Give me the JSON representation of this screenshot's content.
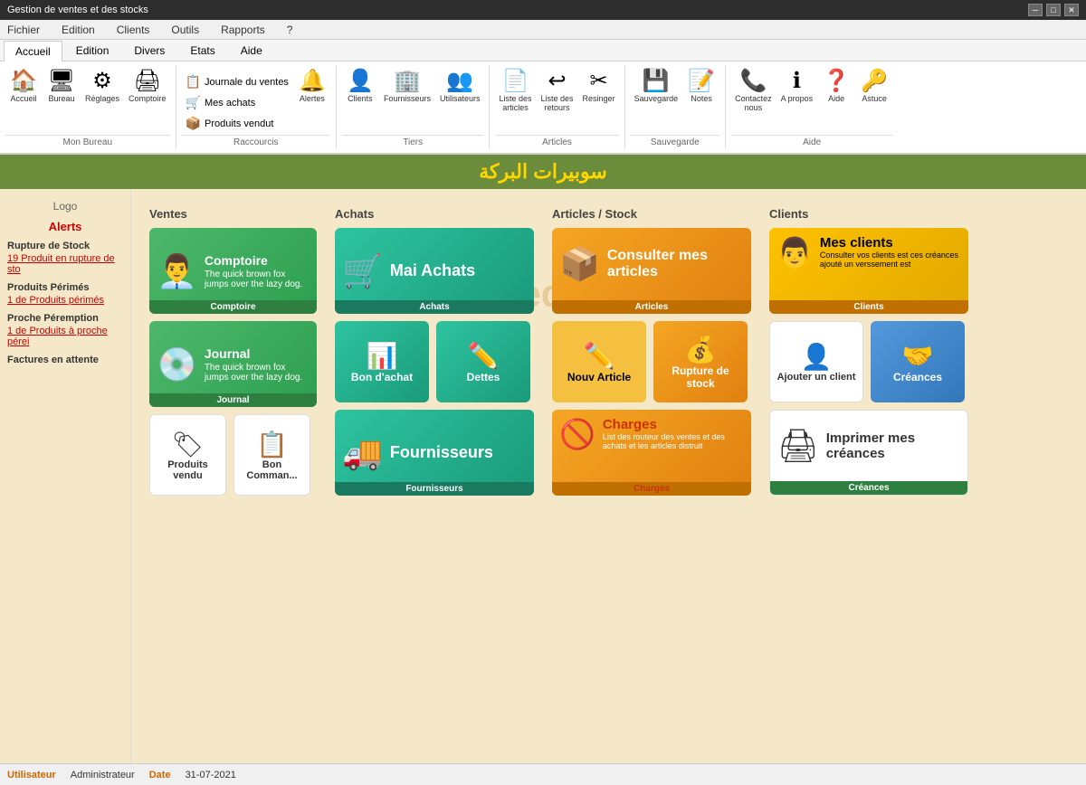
{
  "titlebar": {
    "title": "Gestion de ventes et des stocks",
    "controls": [
      "minimize",
      "maximize",
      "close"
    ]
  },
  "menubar": {
    "items": [
      "Fichier",
      "Edition",
      "Clients",
      "Outils",
      "Rapports",
      "?"
    ]
  },
  "ribbon": {
    "tabs": [
      {
        "label": "Accueil",
        "active": true
      },
      {
        "label": "Edition"
      },
      {
        "label": "Divers"
      },
      {
        "label": "Etats"
      },
      {
        "label": "Aide"
      }
    ],
    "groups": [
      {
        "name": "Mon Bureau",
        "items": [
          {
            "type": "large",
            "icon": "🏠",
            "label": "Accueil"
          },
          {
            "type": "large",
            "icon": "🖥",
            "label": "Bureau"
          },
          {
            "type": "large",
            "icon": "⚙",
            "label": "Réglages"
          },
          {
            "type": "large",
            "icon": "🖨",
            "label": "Comptoire"
          }
        ]
      },
      {
        "name": "Raccourcis",
        "items_small": [
          {
            "icon": "📋",
            "label": "Journale du ventes"
          },
          {
            "icon": "🛒",
            "label": "Mes achats"
          },
          {
            "icon": "📦",
            "label": "Produits vendut"
          }
        ],
        "items_large": [
          {
            "type": "large",
            "icon": "🔔",
            "label": "Alertes"
          }
        ]
      },
      {
        "name": "Tiers",
        "items": [
          {
            "type": "large",
            "icon": "👤",
            "label": "Clients"
          },
          {
            "type": "large",
            "icon": "🏢",
            "label": "Fournisseurs"
          },
          {
            "type": "large",
            "icon": "👥",
            "label": "Utilisateurs"
          }
        ]
      },
      {
        "name": "Articles",
        "items": [
          {
            "type": "large",
            "icon": "📄",
            "label": "Liste des\narticles"
          },
          {
            "type": "large",
            "icon": "↩",
            "label": "Liste des\nretours"
          },
          {
            "type": "large",
            "icon": "✂",
            "label": "Resinger"
          }
        ]
      },
      {
        "name": "Sauvegarde",
        "items": [
          {
            "type": "large",
            "icon": "💾",
            "label": "Sauvegarde"
          },
          {
            "type": "large",
            "icon": "📝",
            "label": "Notes"
          }
        ]
      },
      {
        "name": "Aide",
        "items": [
          {
            "type": "large",
            "icon": "📞",
            "label": "Contactez\nnous"
          },
          {
            "type": "large",
            "icon": "ℹ",
            "label": "A propos"
          },
          {
            "type": "large",
            "icon": "❓",
            "label": "Aide"
          },
          {
            "type": "large",
            "icon": "🔑",
            "label": "Astuce"
          }
        ]
      }
    ]
  },
  "brand": {
    "name": "سوبيرات البركة"
  },
  "sidebar": {
    "logo_label": "Logo",
    "alerts_label": "Alerts",
    "sections": [
      {
        "label": "Rupture de Stock",
        "items": [
          "19 Produit en rupture de sto"
        ]
      },
      {
        "label": "Produits Périmés",
        "items": [
          "1 de Produits périmés"
        ]
      },
      {
        "label": "Proche Péremption",
        "items": [
          "1 de Produits à proche pérei"
        ]
      },
      {
        "label": "Factures en attente",
        "items": []
      }
    ]
  },
  "dashboard": {
    "sections": [
      {
        "id": "ventes",
        "label": "Ventes",
        "cards": [
          {
            "id": "comptoire",
            "title": "Comptoire",
            "subtitle": "The quick brown fox jumps over the lazy dog.",
            "icon": "👨‍💼",
            "style": "green",
            "label": "Comptoire",
            "size": "large"
          },
          {
            "id": "journal",
            "title": "Journal",
            "subtitle": "The quick brown fox jumps over the lazy dog.",
            "icon": "💿",
            "style": "green",
            "label": "Journal",
            "size": "large"
          },
          {
            "id": "produits-vendu",
            "title": "Produits vendu",
            "subtitle": "",
            "icon": "🏷",
            "style": "light",
            "label": "",
            "size": "medium"
          },
          {
            "id": "bon-commande",
            "title": "Bon Comman...",
            "subtitle": "",
            "icon": "📋",
            "style": "light",
            "label": "",
            "size": "medium"
          }
        ]
      },
      {
        "id": "achats",
        "label": "Achats",
        "cards": [
          {
            "id": "mai-achats",
            "title": "Mai Achats",
            "subtitle": "",
            "icon": "🛒",
            "style": "teal",
            "label": "Achats",
            "size": "large"
          },
          {
            "id": "bon-achat",
            "title": "Bon d'achat",
            "subtitle": "",
            "icon": "📊",
            "style": "teal",
            "label": "",
            "size": "medium"
          },
          {
            "id": "dettes",
            "title": "Dettes",
            "subtitle": "",
            "icon": "✏",
            "style": "teal",
            "label": "",
            "size": "medium"
          },
          {
            "id": "fournisseurs-card",
            "title": "Fournisseurs",
            "subtitle": "",
            "icon": "🚚",
            "style": "teal",
            "label": "Fournisseurs",
            "size": "large"
          }
        ]
      },
      {
        "id": "articles-stock",
        "label": "Articles / Stock",
        "cards": [
          {
            "id": "consulter-articles",
            "title": "Consulter mes articles",
            "subtitle": "",
            "icon": "📦",
            "style": "orange",
            "label": "Articles",
            "size": "large"
          },
          {
            "id": "nouv-article",
            "title": "Nouv Article",
            "subtitle": "",
            "icon": "✏",
            "style": "orange-light",
            "label": "",
            "size": "medium"
          },
          {
            "id": "rupture-stock",
            "title": "Rupture de stock",
            "subtitle": "",
            "icon": "💰",
            "style": "orange",
            "label": "",
            "size": "medium"
          },
          {
            "id": "charges",
            "title": "Charges",
            "subtitle": "List des routeur des ventes et des achats et les articles distruit",
            "icon": "🚫",
            "style": "orange",
            "label": "Charges",
            "size": "large"
          }
        ]
      },
      {
        "id": "clients",
        "label": "Clients",
        "cards": [
          {
            "id": "mes-clients",
            "title": "Mes clients",
            "subtitle": "Consulter vos clients est ces créances ajouté un verssement est",
            "icon": "👨",
            "style": "yellow",
            "label": "Clients",
            "size": "large"
          },
          {
            "id": "ajouter-client",
            "title": "Ajouter un client",
            "subtitle": "",
            "icon": "👤+",
            "style": "light",
            "label": "",
            "size": "medium"
          },
          {
            "id": "creances-card",
            "title": "Créances",
            "subtitle": "",
            "icon": "🤝",
            "style": "light-blue",
            "label": "",
            "size": "medium"
          },
          {
            "id": "imprimer-creances",
            "title": "Imprimer mes créances",
            "subtitle": "",
            "icon": "🖨",
            "style": "light",
            "label": "Créances",
            "size": "large"
          }
        ]
      }
    ]
  },
  "statusbar": {
    "user_label": "Utilisateur",
    "user_value": "Administrateur",
    "date_label": "Date",
    "date_value": "31-07-2021"
  }
}
